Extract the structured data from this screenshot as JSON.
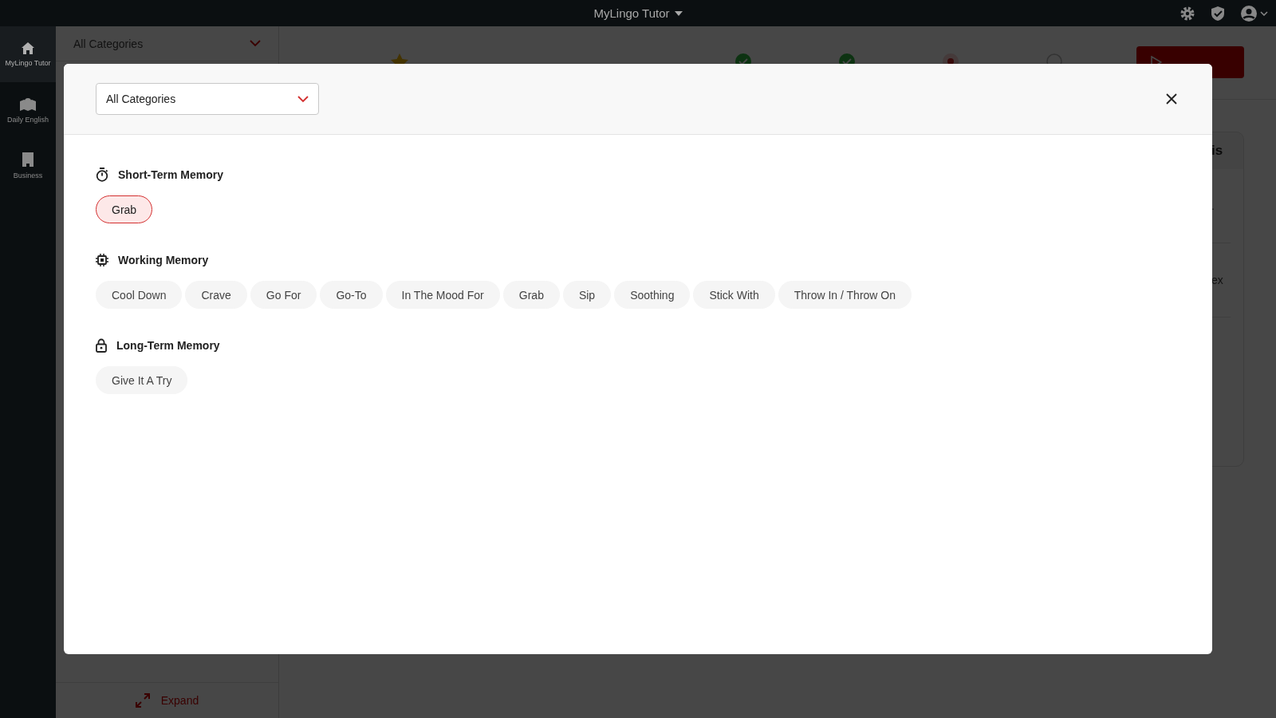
{
  "top_bar": {
    "title": "MyLingo Tutor"
  },
  "nav": [
    {
      "kind": "home",
      "label": "MyLingo Tutor",
      "selected": true
    },
    {
      "kind": "map",
      "label": "Daily English",
      "selected": false
    },
    {
      "kind": "building",
      "label": "Business",
      "selected": false
    }
  ],
  "side_panel": {
    "category_select": {
      "value": "All Categories"
    },
    "expand_button": "Expand"
  },
  "main": {
    "starred": true,
    "steps": [
      {
        "kind": "done"
      },
      {
        "kind": "done"
      },
      {
        "kind": "current"
      },
      {
        "kind": "pending"
      }
    ],
    "card": {
      "heading": "is",
      "lines": [
        ".",
        "ex"
      ]
    }
  },
  "modal": {
    "category_select": {
      "value": "All Categories"
    },
    "sections": [
      {
        "kind": "stopwatch",
        "title": "Short-Term Memory",
        "chips": [
          {
            "label": "Grab",
            "selected": true
          }
        ]
      },
      {
        "kind": "chip",
        "title": "Working Memory",
        "chips": [
          {
            "label": "Cool Down",
            "selected": false
          },
          {
            "label": "Crave",
            "selected": false
          },
          {
            "label": "Go For",
            "selected": false
          },
          {
            "label": "Go-To",
            "selected": false
          },
          {
            "label": "In The Mood For",
            "selected": false
          },
          {
            "label": "Grab",
            "selected": false
          },
          {
            "label": "Sip",
            "selected": false
          },
          {
            "label": "Soothing",
            "selected": false
          },
          {
            "label": "Stick With",
            "selected": false
          },
          {
            "label": "Throw In / Throw On",
            "selected": false
          }
        ]
      },
      {
        "kind": "lock",
        "title": "Long-Term Memory",
        "chips": [
          {
            "label": "Give It A Try",
            "selected": false
          }
        ]
      }
    ]
  }
}
